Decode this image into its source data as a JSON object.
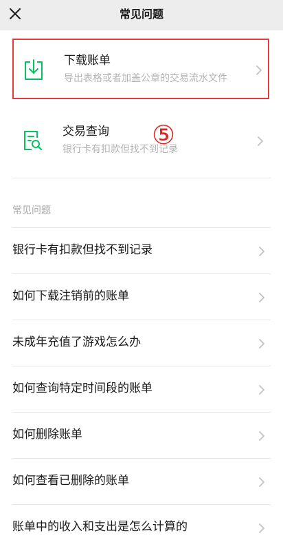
{
  "header": {
    "title": "常见问题",
    "close_icon": "close-icon"
  },
  "actions": [
    {
      "title": "下载账单",
      "description": "导出表格或者加盖公章的交易流水文件",
      "icon": "download-icon",
      "highlighted": true
    },
    {
      "title": "交易查询",
      "description": "银行卡有扣款但找不到记录",
      "icon": "document-search-icon",
      "highlighted": false
    }
  ],
  "step_marker": "⑤",
  "faq": {
    "section_label": "常见问题",
    "items": [
      "银行卡有扣款但找不到记录",
      "如何下载注销前的账单",
      "未成年充值了游戏怎么办",
      "如何查询特定时间段的账单",
      "如何删除账单",
      "如何查看已删除的账单",
      "账单中的收入和支出是怎么计算的"
    ]
  },
  "colors": {
    "accent_green": "#07c160",
    "highlight_red": "#e23b3b",
    "header_bg": "#ededed"
  }
}
